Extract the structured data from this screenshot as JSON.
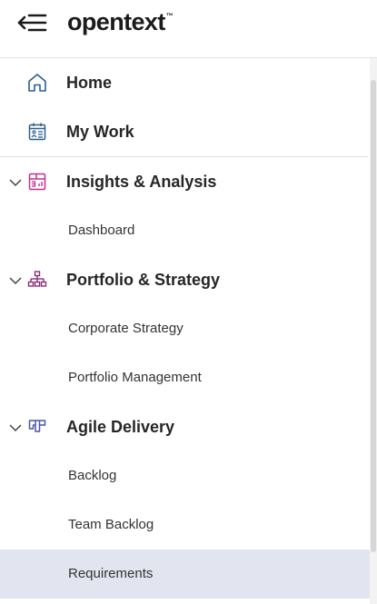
{
  "header": {
    "logo_text": "opentext",
    "logo_tm": "™"
  },
  "nav": {
    "home": "Home",
    "my_work": "My Work",
    "insights": {
      "label": "Insights & Analysis",
      "children": [
        "Dashboard"
      ]
    },
    "portfolio": {
      "label": "Portfolio & Strategy",
      "children": [
        "Corporate Strategy",
        "Portfolio Management"
      ]
    },
    "agile": {
      "label": "Agile Delivery",
      "children": [
        "Backlog",
        "Team Backlog",
        "Requirements"
      ]
    },
    "selected_item": "Requirements"
  },
  "colors": {
    "home_icon": "#2b5f8f",
    "mywork_icon": "#2b5f8f",
    "insights_icon": "#c0308f",
    "portfolio_icon": "#8a2f78",
    "agile_icon": "#4a55a8",
    "selected_bg": "#e2e4f0"
  },
  "icons": {
    "menu_toggle": "collapse-menu-icon",
    "home": "home-icon",
    "my_work": "calendar-list-icon",
    "insights": "chart-dashboard-icon",
    "portfolio": "hierarchy-icon",
    "agile": "kanban-icon",
    "expand": "chevron-down-icon"
  }
}
